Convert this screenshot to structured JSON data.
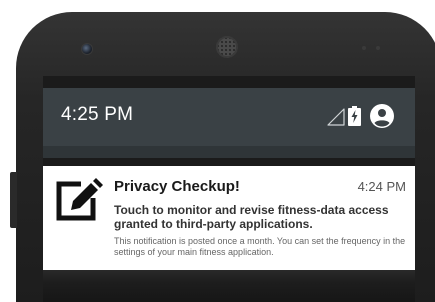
{
  "status_bar": {
    "time": "4:25 PM",
    "icons": [
      "signal-icon",
      "battery-charging-icon",
      "account-circle-icon"
    ]
  },
  "notification": {
    "icon": "edit-icon",
    "title": "Privacy Checkup!",
    "time": "4:24 PM",
    "body": "Touch to monitor and revise fitness-data access granted to third-party applications.",
    "subtext": "This notification is posted once a month. You can set the frequency in the settings of your main fitness application."
  },
  "colors": {
    "status_shade": "#3a4145",
    "notification_bg": "#ffffff",
    "phone_body": "#262626"
  }
}
